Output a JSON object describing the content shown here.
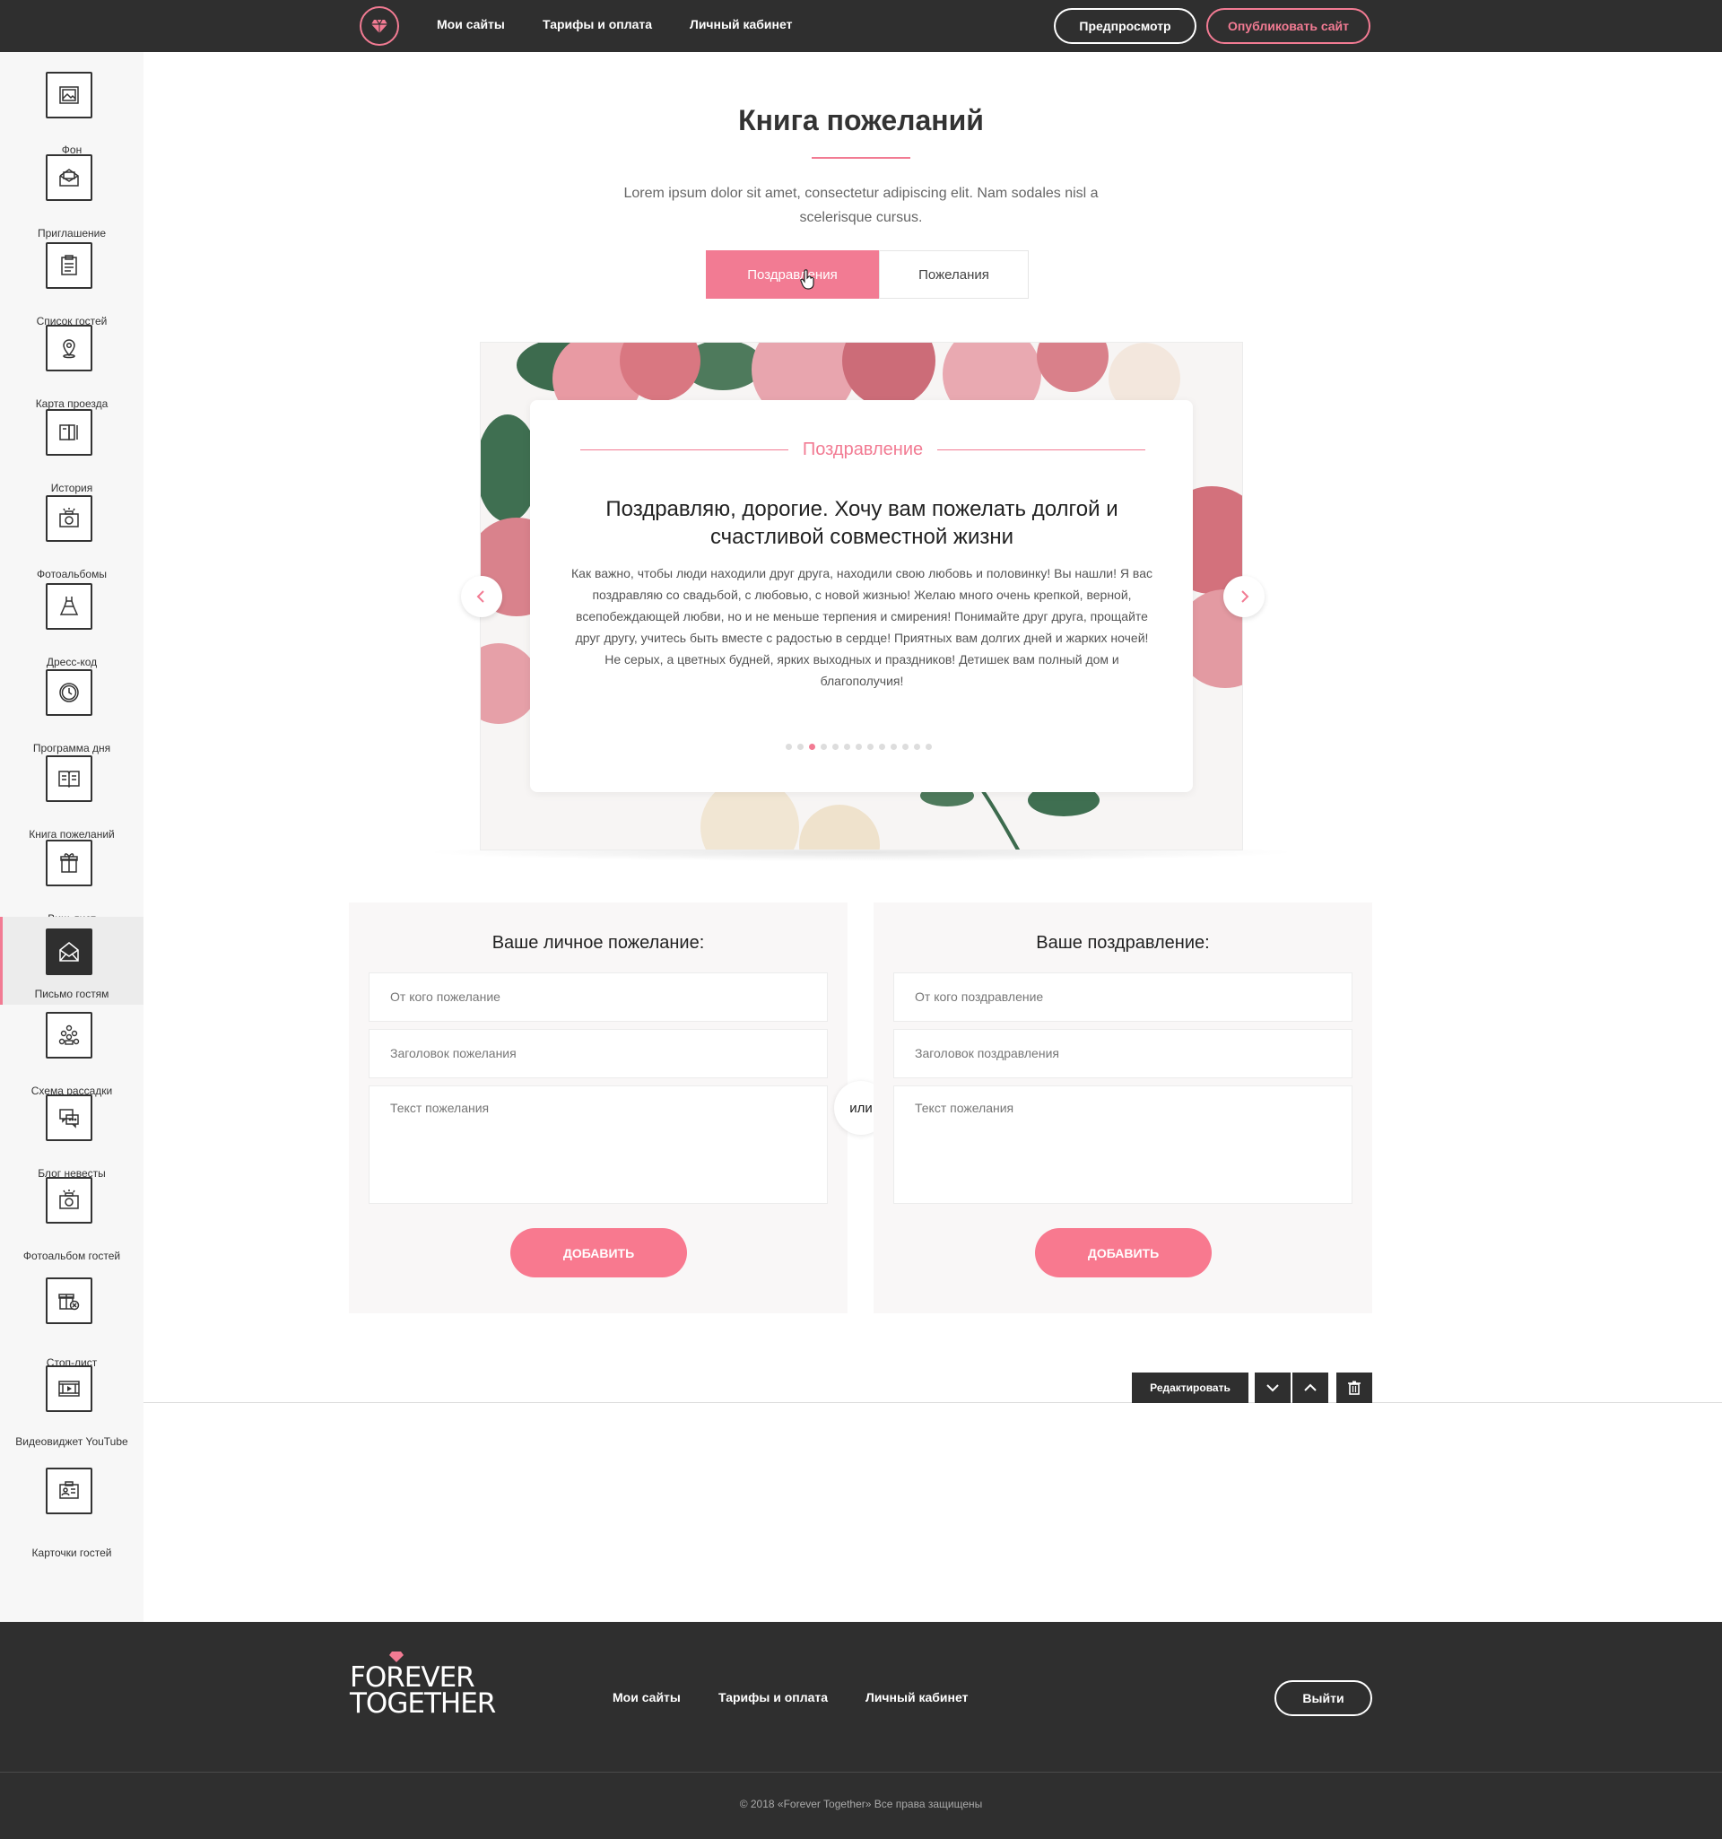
{
  "topnav": {
    "items": [
      "Мои сайты",
      "Тарифы и оплата",
      "Личный кабинет"
    ],
    "preview": "Предпросмотр",
    "publish": "Опубликовать сайт"
  },
  "sidebar": {
    "items": [
      {
        "label": "Фон",
        "icon": "background-image-icon"
      },
      {
        "label": "Приглашение",
        "icon": "invitation-envelope-icon"
      },
      {
        "label": "Список гостей",
        "icon": "guest-list-icon"
      },
      {
        "label": "Карта проезда",
        "icon": "map-pin-icon"
      },
      {
        "label": "История",
        "icon": "history-book-icon"
      },
      {
        "label": "Фотоальбомы",
        "icon": "camera-icon"
      },
      {
        "label": "Дресс-код",
        "icon": "dress-icon"
      },
      {
        "label": "Программа дня",
        "icon": "clock-icon"
      },
      {
        "label": "Книга пожеланий",
        "icon": "open-book-icon"
      },
      {
        "label": "Виш-лист",
        "icon": "gift-icon"
      },
      {
        "label": "Письмо гостям",
        "icon": "letter-icon"
      },
      {
        "label": "Схема рассадки",
        "icon": "seating-icon"
      },
      {
        "label": "Блог невесты",
        "icon": "blog-chat-icon"
      },
      {
        "label": "Фотоальбом гостей",
        "icon": "guest-camera-icon"
      },
      {
        "label": "Стоп-лист",
        "icon": "gift-stop-icon"
      },
      {
        "label": "Видеовиджет YouTube",
        "icon": "video-icon"
      },
      {
        "label": "Карточки гостей",
        "icon": "guest-card-icon"
      }
    ],
    "active_index": 10
  },
  "main": {
    "title": "Книга пожеланий",
    "lead": "Lorem ipsum dolor sit amet, consectetur adipiscing elit. Nam sodales nisl a scelerisque cursus.",
    "tabs": [
      "Поздравления",
      "Пожелания"
    ],
    "active_tab": 0
  },
  "card": {
    "heading": "Поздравление",
    "title": "Поздравляю, дорогие. Хочу вам пожелать долгой и счастливой совместной жизни",
    "text": "Как важно, чтобы люди находили друг друга, находили свою любовь и половинку! Вы нашли! Я вас поздравляю со свадьбой, с любовью, с новой жизнью! Желаю много очень крепкой, верной, всепобеждающей любви, но и не меньше терпения и смирения! Понимайте друг друга, прощайте друг другу, учитесь быть вместе с радостью в сердце! Приятных вам долгих дней и жарких ночей! Не серых, а цветных будней, ярких выходных и праздников! Детишек вам полный дом и благополучия!",
    "dots_total": 13,
    "dot_active": 2
  },
  "forms": {
    "wish": {
      "title": "Ваше личное пожелание:",
      "from_placeholder": "От кого пожелание",
      "subject_placeholder": "Заголовок пожелания",
      "text_placeholder": "Текст пожелания",
      "button": "ДОБАВИТЬ"
    },
    "congrats": {
      "title": "Ваше поздравление:",
      "from_placeholder": "От кого поздравление",
      "subject_placeholder": "Заголовок поздравления",
      "text_placeholder": "Текст пожелания",
      "button": "ДОБАВИТЬ"
    },
    "or_label": "или"
  },
  "toolbar": {
    "edit": "Редактировать"
  },
  "footer": {
    "logo_line1": "FOREVER",
    "logo_line2": "TOGETHER",
    "nav": [
      "Мои сайты",
      "Тарифы и оплата",
      "Личный кабинет"
    ],
    "logout": "Выйти",
    "copyright": "© 2018 «Forever Together» Все права защищены"
  },
  "colors": {
    "accent": "#f27b93",
    "dark": "#2f2f2f"
  }
}
